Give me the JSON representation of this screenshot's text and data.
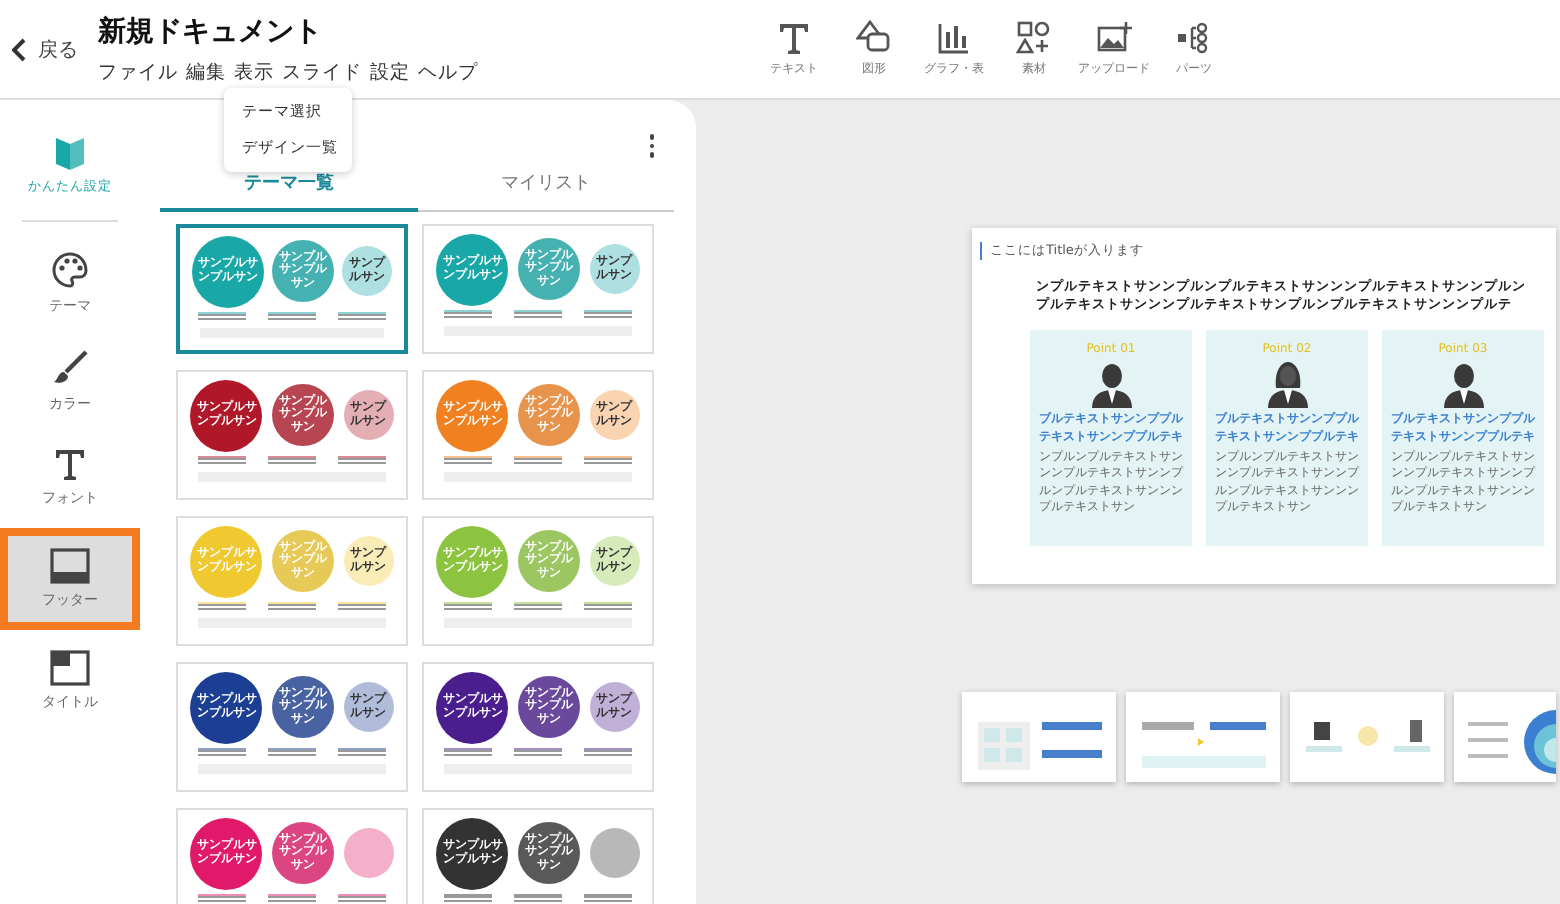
{
  "header": {
    "back": "戻る",
    "title": "新規ドキュメント",
    "menu": [
      "ファイル",
      "編集",
      "表示",
      "スライド",
      "設定",
      "ヘルプ"
    ]
  },
  "toolbar": [
    {
      "kind": "text",
      "label": "テキスト"
    },
    {
      "kind": "shape",
      "label": "図形"
    },
    {
      "kind": "chart",
      "label": "グラフ・表"
    },
    {
      "kind": "material",
      "label": "素材"
    },
    {
      "kind": "upload",
      "label": "アップロード"
    },
    {
      "kind": "parts",
      "label": "パーツ"
    }
  ],
  "dropdown": [
    "テーマ選択",
    "デザイン一覧"
  ],
  "rail": [
    {
      "kind": "beginner",
      "label": "かんたん設定",
      "selected": false
    },
    {
      "kind": "palette",
      "label": "テーマ",
      "selected": false
    },
    {
      "kind": "brush",
      "label": "カラー",
      "selected": false
    },
    {
      "kind": "font",
      "label": "フォント",
      "selected": false
    },
    {
      "kind": "footer",
      "label": "フッター",
      "selected": true
    },
    {
      "kind": "title",
      "label": "タイトル",
      "selected": false
    }
  ],
  "tabs": [
    {
      "label": "テーマ一覧",
      "selected": true
    },
    {
      "label": "マイリスト",
      "selected": false
    }
  ],
  "themes": [
    {
      "color": "#1aa7a8",
      "selected": true,
      "labels": [
        "サンプルサンプルサン",
        "サンプルサンプルサン",
        "サンプルサン"
      ]
    },
    {
      "color": "#1aa7a8",
      "selected": false,
      "labels": [
        "サンプルサンプルサン",
        "サンプルサンプルサン",
        "サンプルサン"
      ]
    },
    {
      "color": "#b0182a",
      "selected": false,
      "labels": [
        "サンプルサンプルサン",
        "サンプルサンプルサン",
        "サンプルサン"
      ]
    },
    {
      "color": "#f08020",
      "selected": false,
      "labels": [
        "サンプルサンプルサン",
        "サンプルサンプルサン",
        "サンプルサン"
      ]
    },
    {
      "color": "#f0c830",
      "selected": false,
      "labels": [
        "サンプルサンプルサン",
        "サンプルサンプルサン",
        "サンプルサン"
      ]
    },
    {
      "color": "#8cc43f",
      "selected": false,
      "labels": [
        "サンプルサンプルサン",
        "サンプルサンプルサン",
        "サンプルサン"
      ]
    },
    {
      "color": "#1c3f94",
      "selected": false,
      "labels": [
        "サンプルサンプルサン",
        "サンプルサンプルサン",
        "サンプルサン"
      ]
    },
    {
      "color": "#4a1e8c",
      "selected": false,
      "labels": [
        "サンプルサンプルサン",
        "サンプルサンプルサン",
        "サンプルサン"
      ]
    },
    {
      "color": "#e0196a",
      "selected": false,
      "labels": [
        "サンプルサンプルサン",
        "サンプルサンプルサン"
      ]
    },
    {
      "color": "#333333",
      "selected": false,
      "labels": [
        "サンプルサンプルサン",
        "サンプルサンプルサン"
      ]
    }
  ],
  "slide": {
    "title": "ここにはTitleが入ります",
    "headline": [
      "ンプルテキストサンンプルンプルテキストサンンンプルテキストサンンプルン",
      "プルテキストサンンンプルテキストサンプルンプルテキストサンンンプルテ"
    ],
    "points": [
      {
        "kind": "man",
        "label": "Point 01",
        "heading": "ブルテキストサンンププルテキストサンンププルテキ",
        "body": "ンプルンプルテキストサンンンプルテキストサンンプルンプルテキストサンンンプルテキストサン"
      },
      {
        "kind": "woman",
        "label": "Point 02",
        "heading": "ブルテキストサンンププルテキストサンンププルテキ",
        "body": "ンプルンプルテキストサンンンプルテキストサンンプルンプルテキストサンンンプルテキストサン"
      },
      {
        "kind": "man",
        "label": "Point 03",
        "heading": "ブルテキストサンンププルテキストサンンププルテキ",
        "body": "ンプルンプルテキストサンンンプルテキストサンンプルンプルテキストサンンンプルテキストサン"
      }
    ]
  },
  "strip": [
    {
      "kind": "grid"
    },
    {
      "kind": "compare"
    },
    {
      "kind": "flow"
    },
    {
      "kind": "rings"
    }
  ]
}
